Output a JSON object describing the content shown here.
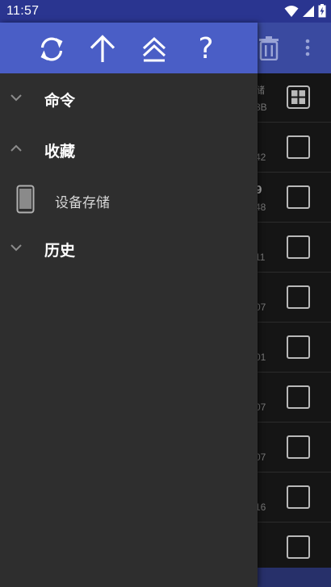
{
  "status_bar": {
    "time": "11:57",
    "icons": [
      "wifi-icon",
      "cell-signal-icon",
      "battery-charging-icon"
    ]
  },
  "background": {
    "toolbar_icons": [
      "trash-icon",
      "more-vert-icon"
    ],
    "rows": [
      {
        "top": "储",
        "bottom": "3B",
        "icon": "grid-icon"
      },
      {
        "top": "",
        "bottom": "42",
        "icon": "checkbox"
      },
      {
        "top": "9",
        "bottom": "48",
        "icon": "checkbox"
      },
      {
        "top": "",
        "bottom": "11",
        "icon": "checkbox"
      },
      {
        "top": "",
        "bottom": "07",
        "icon": "checkbox"
      },
      {
        "top": "",
        "bottom": "01",
        "icon": "checkbox"
      },
      {
        "top": "",
        "bottom": "07",
        "icon": "checkbox"
      },
      {
        "top": "",
        "bottom": "07",
        "icon": "checkbox"
      },
      {
        "top": "",
        "bottom": "16",
        "icon": "checkbox"
      },
      {
        "top": "",
        "bottom": "",
        "icon": "checkbox"
      }
    ]
  },
  "drawer": {
    "header_icons": [
      "refresh-icon",
      "arrow-up-icon",
      "double-chevron-up-icon",
      "help-icon"
    ],
    "help_glyph": "?",
    "sections": {
      "commands": "命令",
      "favorites": "收藏",
      "history": "历史"
    },
    "favorites_items": [
      {
        "label": "设备存储",
        "icon": "phone-icon"
      }
    ]
  },
  "colors": {
    "status_bar": "#2a3590",
    "drawer_header": "#4a5ec6",
    "drawer_bg": "#2e2e2e",
    "app_bg": "#151515"
  }
}
